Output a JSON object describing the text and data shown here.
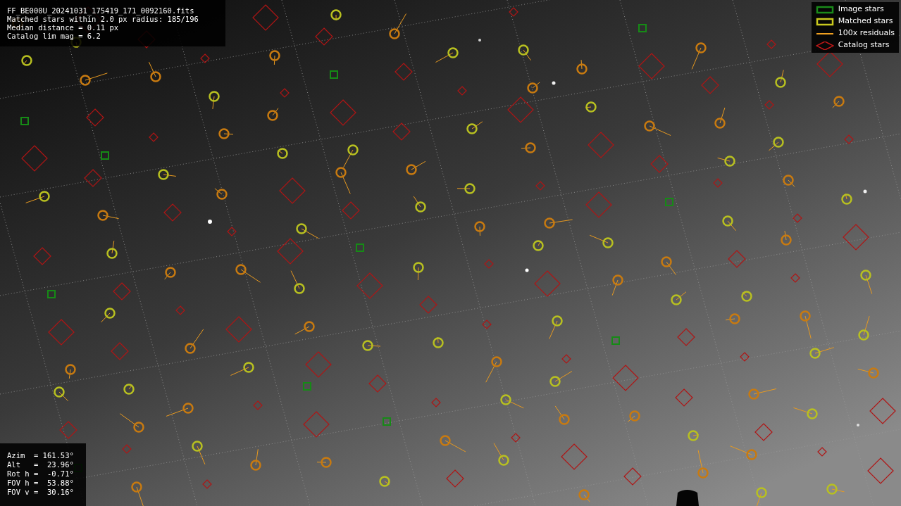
{
  "info": [
    "FF_BE000U_20241031_175419_171_0092160.fits",
    "Matched stars within 2.0 px radius: 185/196",
    "Median distance = 0.11 px",
    "Catalog lim mag = 6.2"
  ],
  "legend": [
    {
      "label": "Image stars",
      "color": "#1a8a1a"
    },
    {
      "kind": "matched",
      "label": "Matched stars",
      "color": "#c8c81e"
    },
    {
      "kind": "residual",
      "label": "100x residuals",
      "color": "#f0a020"
    },
    {
      "kind": "catalog",
      "label": "Catalog stars",
      "color": "#c01818"
    }
  ],
  "pointing": [
    "Azim  = 161.53°",
    "Alt   =  23.96°",
    "Rot h =  -0.71°",
    "FOV h =  53.88°",
    "FOV v =  30.16°"
  ]
}
